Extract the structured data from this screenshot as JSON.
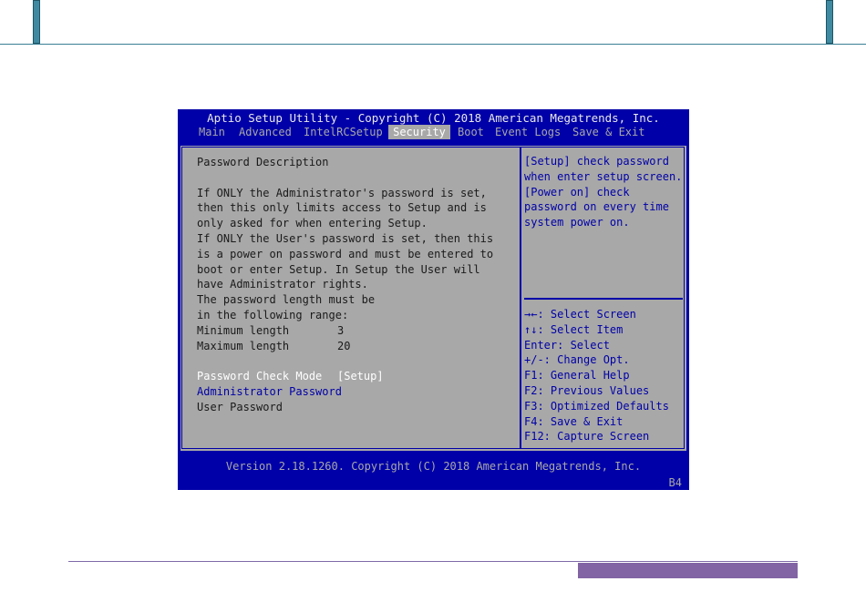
{
  "bios": {
    "title": "Aptio Setup Utility - Copyright (C) 2018 American Megatrends, Inc.",
    "menu": [
      "Main",
      "Advanced",
      "IntelRCSetup",
      "Security",
      "Boot",
      "Event Logs",
      "Save & Exit"
    ],
    "active_menu": "Security",
    "description_lines": [
      "Password Description",
      "",
      "If ONLY the Administrator's password is set,",
      "then this only limits access to Setup and is",
      "only asked for when entering Setup.",
      "If ONLY the User's password is set, then this",
      "is a power on password and must be entered to",
      "boot or enter Setup. In Setup the User will",
      "have Administrator rights.",
      "The password length must be",
      "in the following range:"
    ],
    "min_length_label": "Minimum length",
    "min_length_value": "3",
    "max_length_label": "Maximum length",
    "max_length_value": "20",
    "options": {
      "password_check_mode_label": "Password Check Mode",
      "password_check_mode_value": "[Setup]",
      "administrator_password_label": "Administrator Password",
      "user_password_label": "User Password"
    },
    "help_text": [
      "[Setup] check password",
      "when enter setup screen.",
      "[Power on] check",
      "password on every time",
      "system power on."
    ],
    "keys": [
      "→←: Select Screen",
      "↑↓: Select Item",
      "Enter: Select",
      "+/-: Change Opt.",
      "F1: General Help",
      "F2: Previous Values",
      "F3: Optimized Defaults",
      "F4: Save & Exit",
      "F12: Capture Screen"
    ],
    "footer": "Version 2.18.1260. Copyright (C) 2018 American Megatrends, Inc.",
    "footer_code": "B4"
  },
  "colors": {
    "bios_blue": "#0000a8",
    "bios_gray": "#a8a8a8",
    "page_accent_teal": "#3f8aa0",
    "page_accent_purple": "#8264a5"
  }
}
